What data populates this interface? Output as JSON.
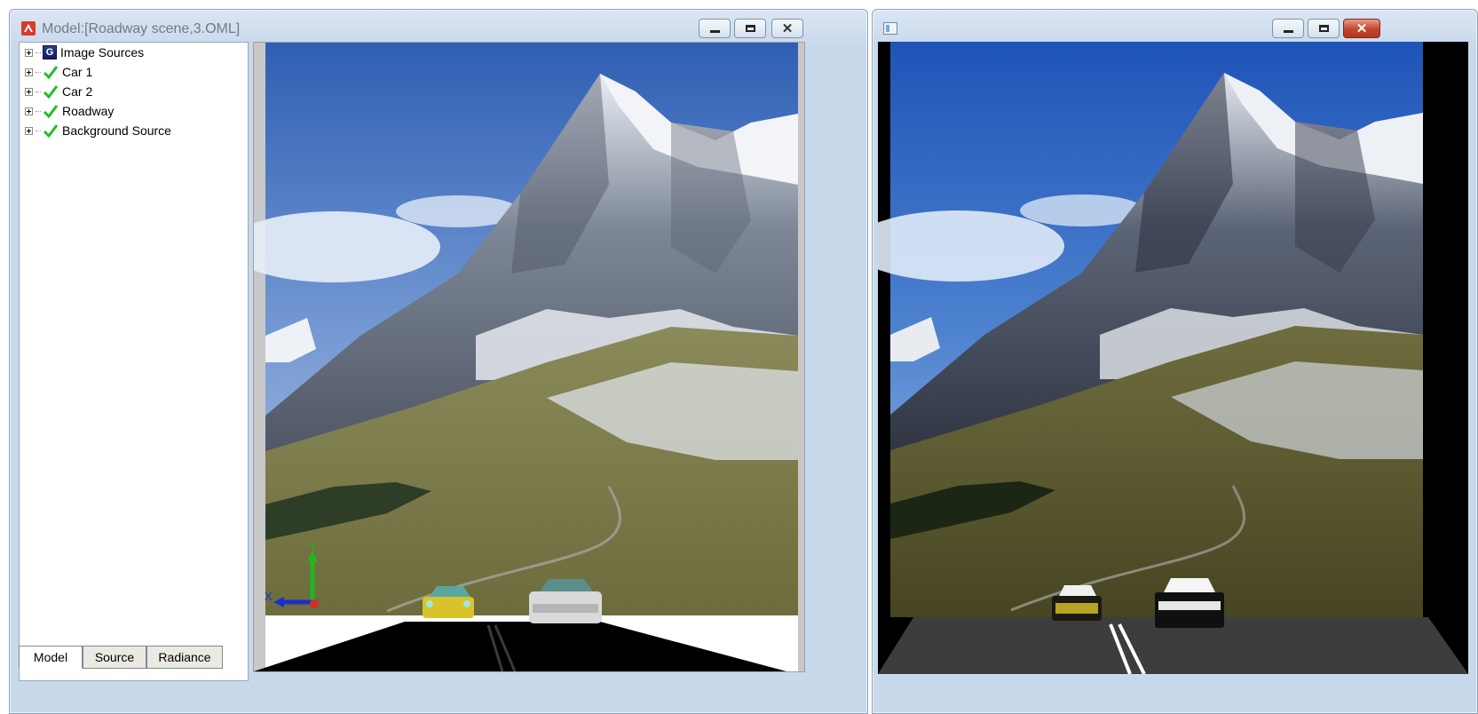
{
  "left_window": {
    "title": "Model:[Roadway scene,3.OML]",
    "controls": {
      "minimize_label": "minimize",
      "maximize_label": "maximize",
      "close_label": "close"
    }
  },
  "tree": {
    "items": [
      {
        "label": "Image Sources",
        "icon": "image-source-icon"
      },
      {
        "label": "Car 1",
        "icon": "check-icon"
      },
      {
        "label": "Car 2",
        "icon": "check-icon"
      },
      {
        "label": "Roadway",
        "icon": "check-icon"
      },
      {
        "label": "Background Source",
        "icon": "check-icon"
      }
    ]
  },
  "tabs": [
    {
      "label": "Model",
      "active": true
    },
    {
      "label": "Source",
      "active": false
    },
    {
      "label": "Radiance",
      "active": false
    }
  ],
  "viewport": {
    "axis_labels": {
      "x": "X",
      "y": "Y"
    }
  },
  "right_window": {
    "title": "",
    "controls": {
      "minimize_label": "minimize",
      "maximize_label": "maximize",
      "close_label": "close"
    }
  },
  "colors": {
    "sky": "#3f6fbe",
    "car1": "#d8c32a",
    "car2": "#d9d9d9",
    "road": "#000000",
    "close_button": "#c2452d"
  }
}
